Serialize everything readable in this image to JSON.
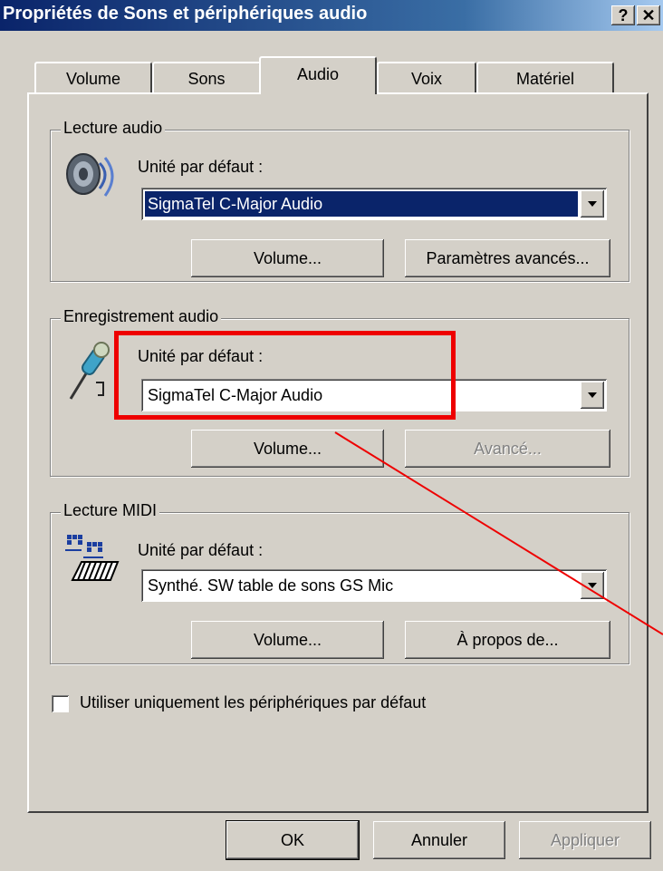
{
  "window": {
    "title": "Propriétés de Sons et périphériques audio",
    "help_button": "?",
    "close_button": "✕"
  },
  "tabs": [
    {
      "label": "Volume",
      "active": false
    },
    {
      "label": "Sons",
      "active": false
    },
    {
      "label": "Audio",
      "active": true
    },
    {
      "label": "Voix",
      "active": false
    },
    {
      "label": "Matériel",
      "active": false
    }
  ],
  "playback": {
    "group_label": "Lecture audio",
    "device_label": "Unité par défaut :",
    "device_value": "SigmaTel C-Major Audio",
    "volume_button": "Volume...",
    "advanced_button": "Paramètres avancés..."
  },
  "recording": {
    "group_label": "Enregistrement audio",
    "device_label": "Unité par défaut :",
    "device_value": "SigmaTel C-Major Audio",
    "volume_button": "Volume...",
    "advanced_button": "Avancé..."
  },
  "midi": {
    "group_label": "Lecture MIDI",
    "device_label": "Unité par défaut :",
    "device_value": "Synthé. SW table de sons GS Mic",
    "volume_button": "Volume...",
    "about_button": "À propos de..."
  },
  "default_only_checkbox": {
    "label": "Utiliser uniquement les périphériques par défaut",
    "checked": false
  },
  "footer": {
    "ok": "OK",
    "cancel": "Annuler",
    "apply": "Appliquer"
  },
  "colors": {
    "title_gradient_start": "#0a246a",
    "dialog_face": "#d4d0c8",
    "highlight_annotation": "#ee0000",
    "selection": "#0a246a"
  },
  "icons": {
    "playback": "speaker-icon",
    "recording": "microphone-icon",
    "midi": "midi-keyboard-icon"
  }
}
